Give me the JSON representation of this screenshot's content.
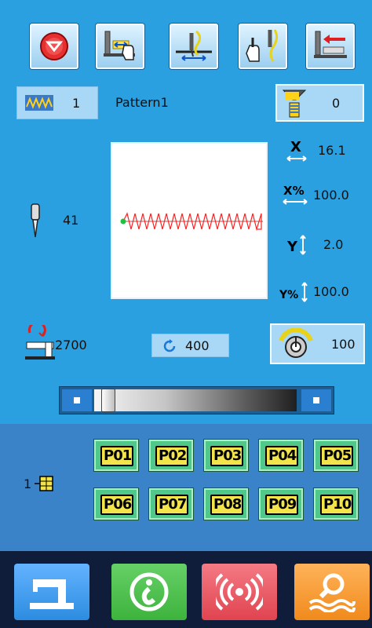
{
  "colors": {
    "main_bg": "#2aa0e0",
    "pattern_panel_bg": "#3a83c9",
    "bottom_bar_bg": "#0f1d3a",
    "pattern_button": "#4fc88a",
    "pattern_label": "#f2e44a",
    "stitch_red": "#ff2020",
    "start_green": "#20c040"
  },
  "toolbar": {
    "icons": [
      "stop-icon",
      "feed-adjust-icon",
      "thread-tension-icon",
      "manual-threading-icon",
      "presser-foot-icon"
    ]
  },
  "pattern": {
    "icon": "zigzag-icon",
    "number": "1",
    "name": "Pattern1"
  },
  "counter": {
    "icon": "bobbin-counter-icon",
    "value": "0"
  },
  "params": {
    "x_scale": {
      "icon": "x-scale-icon",
      "value": "16.1"
    },
    "x_percent": {
      "icon": "x-percent-icon",
      "value": "100.0"
    },
    "y_scale": {
      "icon": "y-scale-icon",
      "value": "2.0"
    },
    "y_percent": {
      "icon": "y-percent-icon",
      "value": "100.0"
    }
  },
  "stitch": {
    "icon": "needle-icon",
    "count": "41"
  },
  "speed": {
    "machine_icon": "sewing-speed-icon",
    "max": "2700",
    "set": "400",
    "jog_value": "100"
  },
  "slider": {
    "position_fraction": 0.02
  },
  "pattern_bank": {
    "page": "1",
    "page_icon": "grid-icon",
    "buttons": [
      "P01",
      "P02",
      "P03",
      "P04",
      "P05",
      "P06",
      "P07",
      "P08",
      "P09",
      "P10"
    ]
  },
  "bottom_bar": {
    "items": [
      {
        "icon": "sewing-machine-icon",
        "color": "#2d8ce0"
      },
      {
        "icon": "info-icon",
        "color": "#3db33d"
      },
      {
        "icon": "communication-icon",
        "color": "#e0444f"
      },
      {
        "icon": "search-icon",
        "color": "#f08a1c"
      }
    ]
  }
}
